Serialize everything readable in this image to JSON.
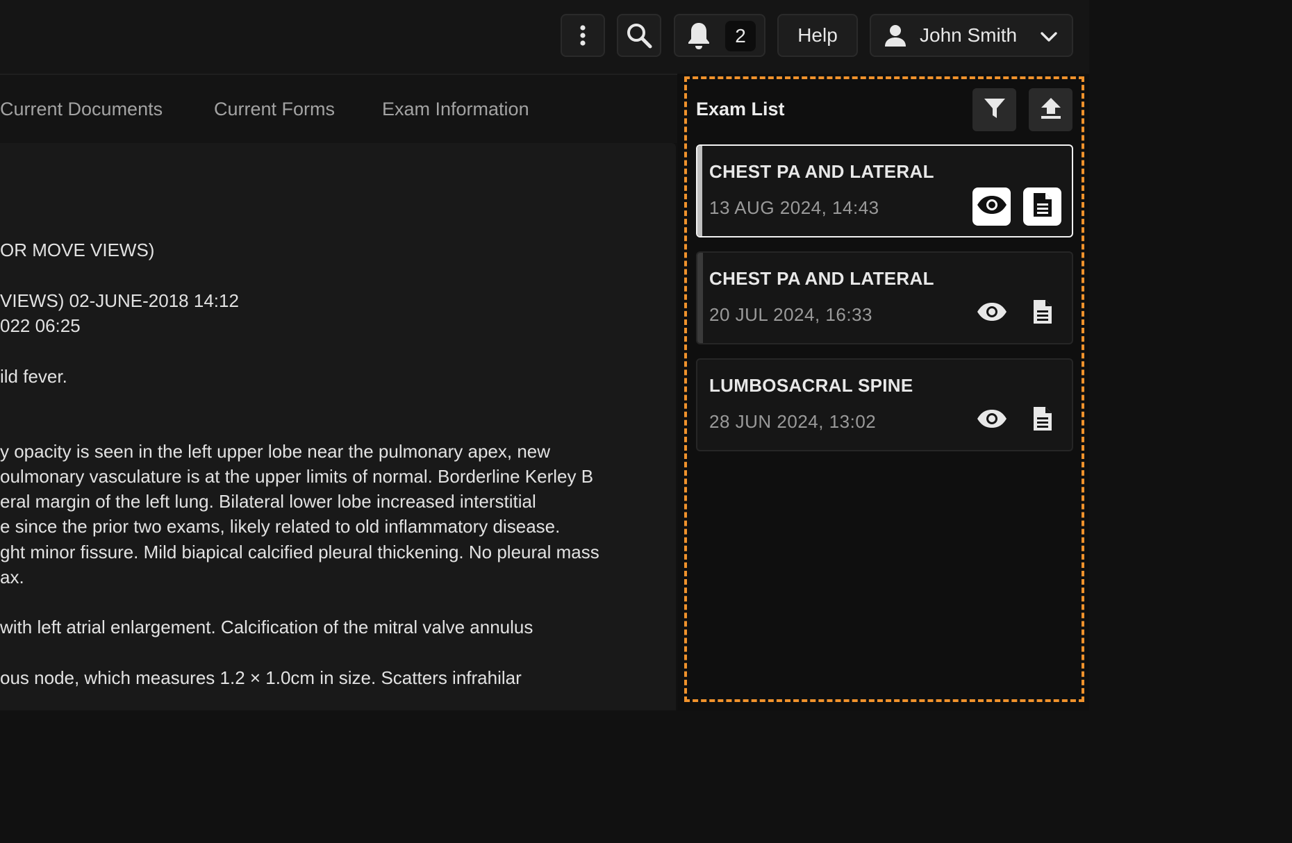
{
  "header": {
    "more_icon": "more-vertical-icon",
    "search_icon": "search-icon",
    "notification_icon": "bell-icon",
    "notification_count": "2",
    "help_label": "Help",
    "user_icon": "user-icon",
    "user_name": "John Smith",
    "user_menu_icon": "chevron-down-icon"
  },
  "tabs": [
    {
      "label": "Current Documents"
    },
    {
      "label": "Current Forms"
    },
    {
      "label": "Exam Information"
    }
  ],
  "document": {
    "lines": [
      " OR MOVE VIEWS)",
      "VIEWS) 02-JUNE-2018 14:12",
      "022 06:25",
      "ild fever.",
      "y opacity is seen in the left upper lobe near the pulmonary apex, new",
      "oulmonary vasculature is at the upper limits of normal. Borderline Kerley B",
      "eral margin of the left lung. Bilateral lower lobe increased interstitial",
      "e since the prior two exams, likely related to old inflammatory disease.",
      "ght minor fissure. Mild biapical calcified pleural thickening. No pleural mass",
      "ax.",
      " with left atrial enlargement. Calcification of the mitral valve annulus",
      "ous node, which measures 1.2 × 1.0cm in size. Scatters infrahilar"
    ]
  },
  "exam_list": {
    "title": "Exam List",
    "filter_icon": "filter-icon",
    "upload_icon": "upload-icon",
    "highlight_color": "#f0922c",
    "items": [
      {
        "title": "CHEST PA AND LATERAL",
        "date": "13 AUG 2024, 14:43",
        "selected": true,
        "view_icon": "eye-icon",
        "report_icon": "document-icon"
      },
      {
        "title": "CHEST PA AND LATERAL",
        "date": "20 JUL 2024, 16:33",
        "selected": false,
        "view_icon": "eye-icon",
        "report_icon": "document-icon"
      },
      {
        "title": "LUMBOSACRAL SPINE",
        "date": "28 JUN 2024, 13:02",
        "selected": false,
        "view_icon": "eye-icon",
        "report_icon": "document-icon"
      }
    ]
  }
}
